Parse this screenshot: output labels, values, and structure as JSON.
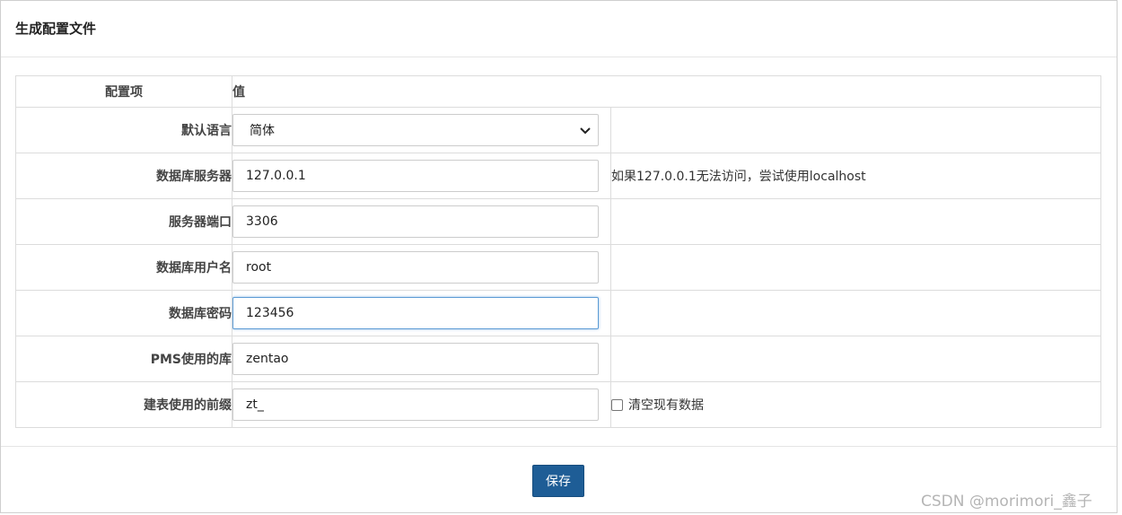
{
  "header": {
    "title": "生成配置文件"
  },
  "table": {
    "header_label": "配置项",
    "header_value": "值",
    "rows": [
      {
        "label": "默认语言",
        "value": "简体",
        "extra": ""
      },
      {
        "label": "数据库服务器",
        "value": "127.0.0.1",
        "extra": "如果127.0.0.1无法访问，尝试使用localhost"
      },
      {
        "label": "服务器端口",
        "value": "3306",
        "extra": ""
      },
      {
        "label": "数据库用户名",
        "value": "root",
        "extra": ""
      },
      {
        "label": "数据库密码",
        "value": "123456",
        "extra": ""
      },
      {
        "label": "PMS使用的库",
        "value": "zentao",
        "extra": ""
      },
      {
        "label": "建表使用的前缀",
        "value": "zt_",
        "extra": ""
      }
    ],
    "clear_checkbox_label": "清空现有数据"
  },
  "footer": {
    "save_label": "保存"
  },
  "watermark": "CSDN @morimori_鑫子",
  "colors": {
    "primary_button": "#1e5d96",
    "focus_border": "#5b9bd5"
  }
}
